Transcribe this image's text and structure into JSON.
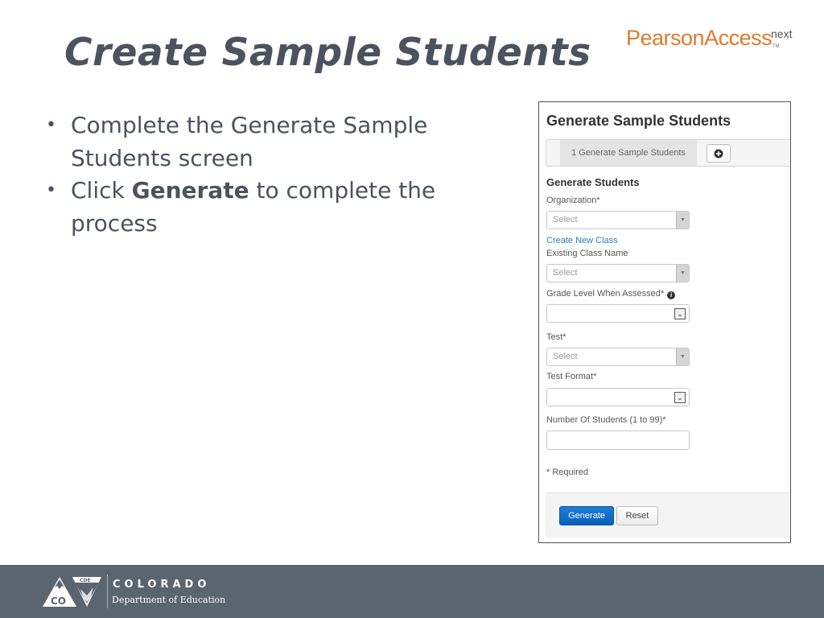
{
  "slide": {
    "title": "Create Sample Students",
    "bullets": [
      {
        "text": "Complete the Generate Sample Students screen"
      },
      {
        "pre": "Click ",
        "bold": "Generate",
        "post": " to complete the process"
      }
    ]
  },
  "brand": {
    "name": "PearsonAccess",
    "sup": "next",
    "tm": "TM",
    "color": "#e07a2e"
  },
  "screen": {
    "title": "Generate Sample Students",
    "wizard": {
      "step_label": "1 Generate Sample Students",
      "add_icon": "plus-circle-icon"
    },
    "section_title": "Generate Students",
    "fields": {
      "organization": {
        "label": "Organization*",
        "placeholder": "Select"
      },
      "create_class_link": "Create New Class",
      "existing_class": {
        "label": "Existing Class Name",
        "placeholder": "Select"
      },
      "grade_level": {
        "label": "Grade Level When Assessed*",
        "value": ""
      },
      "test": {
        "label": "Test*",
        "placeholder": "Select"
      },
      "test_format": {
        "label": "Test Format*",
        "value": ""
      },
      "num_students": {
        "label": "Number Of Students (1 to 99)*",
        "value": ""
      }
    },
    "required_note": "* Required",
    "buttons": {
      "generate": "Generate",
      "reset": "Reset"
    },
    "accent": "#1d7fd6"
  },
  "footer": {
    "org_name": "COLORADO",
    "dept": "Department of Education",
    "logo_left": "CO",
    "logo_right": "CDE",
    "band_color": "#5b6570"
  }
}
